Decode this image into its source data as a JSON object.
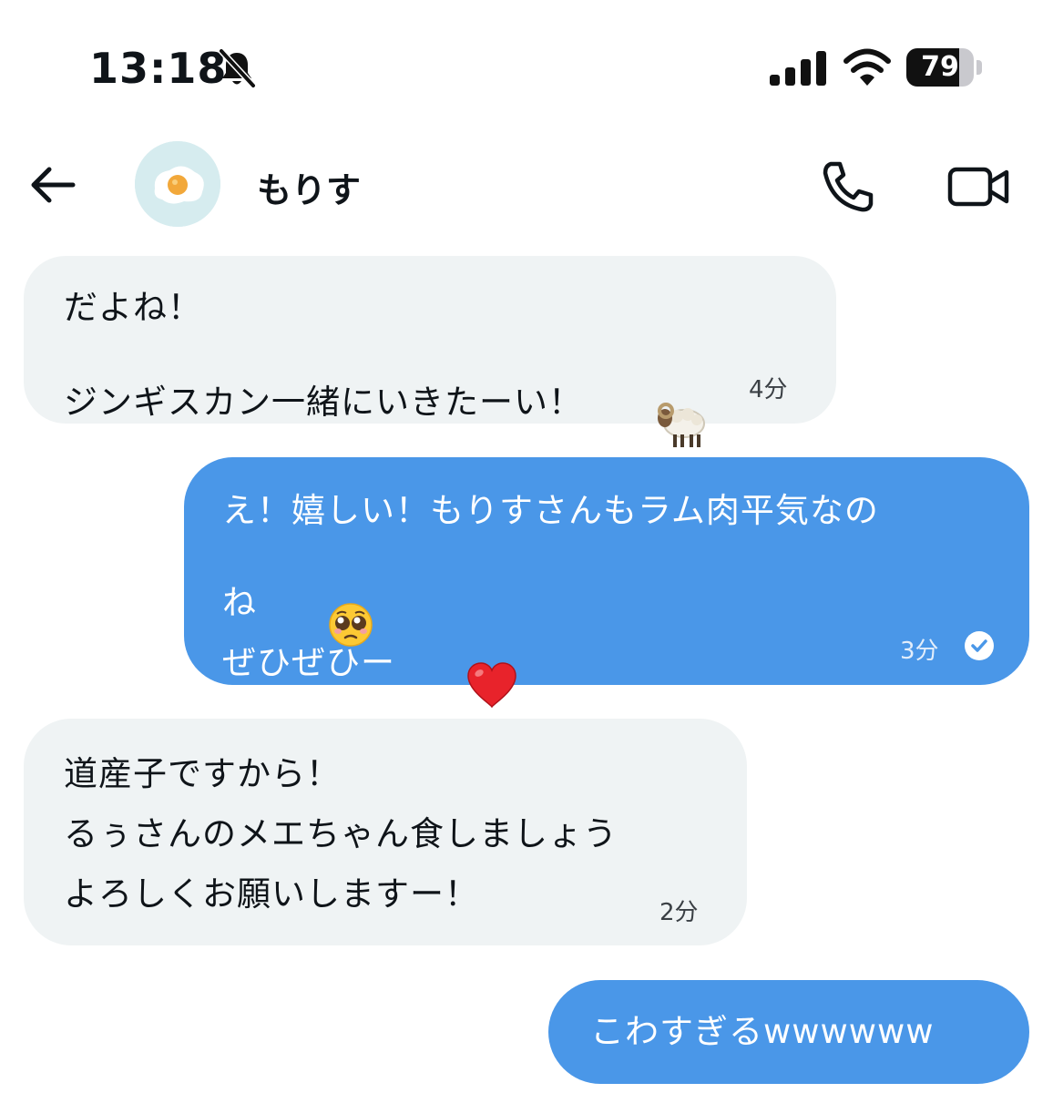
{
  "status": {
    "time": "13:18",
    "battery": "79",
    "battery_level_percent": 79,
    "icons": [
      "bell-slash-icon",
      "cellular-signal-icon",
      "wifi-icon",
      "battery-icon"
    ]
  },
  "header": {
    "contact_name": "もりす",
    "avatar": "fried-egg-avatar",
    "icons": [
      "back-arrow-icon",
      "phone-call-icon",
      "video-call-icon"
    ]
  },
  "messages": [
    {
      "direction": "incoming",
      "lines": [
        "だよね！",
        "ジンギスカン一緒にいきたーい！"
      ],
      "emoji": "ram",
      "time": "4分"
    },
    {
      "direction": "outgoing",
      "lines": [
        "え！嬉しい！もりすさんもラム肉平気なの",
        "ね",
        "ぜひぜひー"
      ],
      "emoji": [
        "pleading-face",
        "red-heart"
      ],
      "time": "3分",
      "status_icon": "read-check-icon"
    },
    {
      "direction": "incoming",
      "lines": [
        "道産子ですから！",
        "るぅさんのメエちゃん食しましょう",
        "よろしくお願いしますー！"
      ],
      "time": "2分"
    },
    {
      "direction": "outgoing",
      "lines": [
        "こわすぎるwwwwww"
      ]
    }
  ]
}
